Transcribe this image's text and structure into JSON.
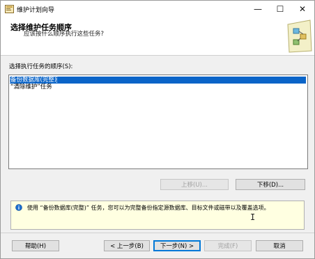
{
  "window": {
    "title": "维护计划向导",
    "minimize": "—",
    "maximize": "☐",
    "close": "✕"
  },
  "header": {
    "title": "选择维护任务顺序",
    "subtitle": "应该按什么顺序执行这些任务?"
  },
  "order_label": "选择执行任务的顺序(S):",
  "tasks": [
    {
      "label": "备份数据库(完整)",
      "selected": true
    },
    {
      "label": "“清除维护”任务",
      "selected": false
    }
  ],
  "move_buttons": {
    "up": "上移(U)...",
    "down": "下移(D)..."
  },
  "info": {
    "icon": "info-icon",
    "text": "使用 “备份数据库(完整)” 任务，您可以为完整备份指定源数据库、目标文件或磁带以及覆盖选项。"
  },
  "footer": {
    "help": "帮助(H)",
    "back": "< 上一步(B)",
    "next": "下一步(N) >",
    "finish": "完成(F)",
    "cancel": "取消"
  },
  "colors": {
    "selection": "#0a64c8",
    "info_bg": "#ffffe1",
    "focus": "#0078d7"
  }
}
